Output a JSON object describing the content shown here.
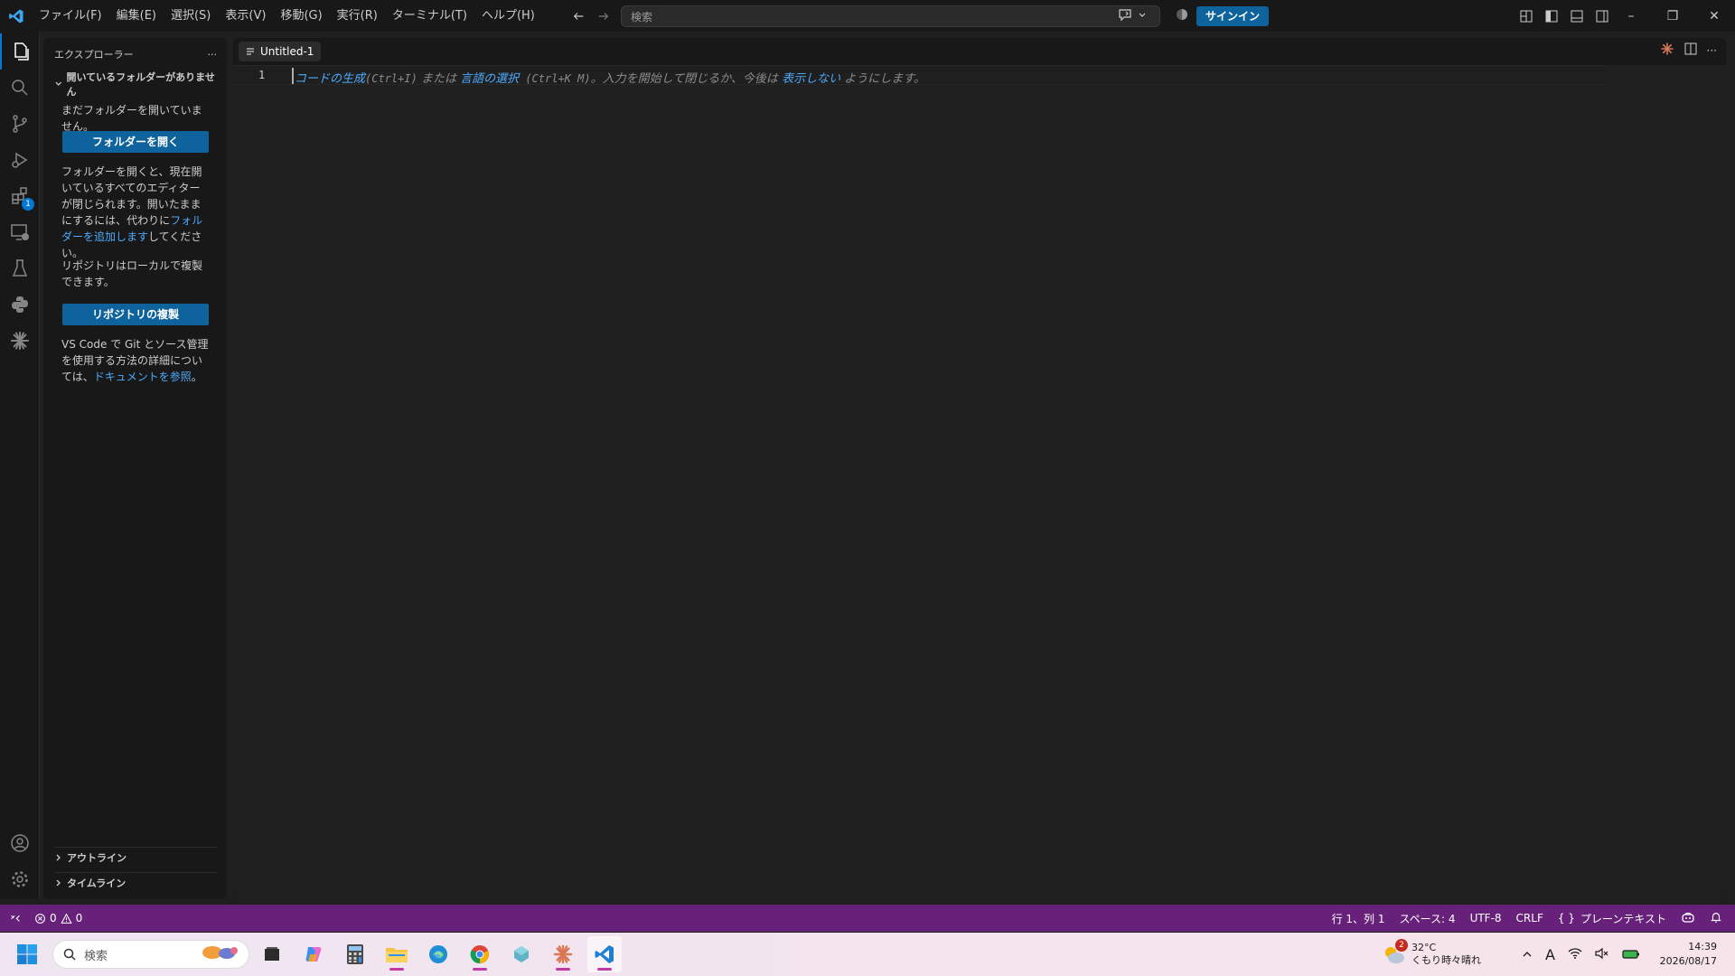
{
  "titlebar": {
    "menu": [
      "ファイル(F)",
      "編集(E)",
      "選択(S)",
      "表示(V)",
      "移動(G)",
      "実行(R)",
      "ターミナル(T)",
      "ヘルプ(H)"
    ],
    "search_placeholder": "検索",
    "signin_label": "サインイン"
  },
  "activitybar": {
    "extensions_badge": "1"
  },
  "sidebar": {
    "title": "エクスプローラー",
    "more": "···",
    "section_title": "開いているフォルダーがありません",
    "no_folder_text": "まだフォルダーを開いていません。",
    "open_folder_button": "フォルダーを開く",
    "info_text_1": "フォルダーを開くと、現在開いているすべてのエディターが閉じられます。開いたままにするには、代わりに",
    "add_folder_link": "フォルダーを追加します",
    "info_text_2": "してください。",
    "repo_text": "リポジトリはローカルで複製できます。",
    "clone_button": "リポジトリの複製",
    "git_text": "VS Code で Git とソース管理を使用する方法の詳細については、",
    "docs_link": "ドキュメントを参照",
    "git_text_end": "。",
    "outline_label": "アウトライン",
    "timeline_label": "タイムライン"
  },
  "editor": {
    "tab_label": "Untitled-1",
    "line_number": "1",
    "hint_generate": "コードの生成",
    "hint_ctrl_i": "(Ctrl+I)",
    "hint_or": " または ",
    "hint_language": "言語の選択",
    "hint_ctrl_k": " (Ctrl+K M)",
    "hint_middle": "。入力を開始して閉じるか、今後は ",
    "hint_dont_show": "表示しない",
    "hint_end": " ようにします。"
  },
  "statusbar": {
    "errors": "0",
    "warnings": "0",
    "position": "行 1、列 1",
    "spaces": "スペース: 4",
    "encoding": "UTF-8",
    "eol": "CRLF",
    "language": "プレーンテキスト"
  },
  "taskbar": {
    "search_placeholder": "検索",
    "weather_badge": "2",
    "temperature": "32°C",
    "weather_desc": "くもり時々晴れ",
    "ime": "A",
    "time": "14:39",
    "date": "2026/08/17"
  },
  "colors": {
    "accent": "#0078d4",
    "button": "#0e639c",
    "statusbar": "#68217a",
    "link": "#4daafc"
  }
}
